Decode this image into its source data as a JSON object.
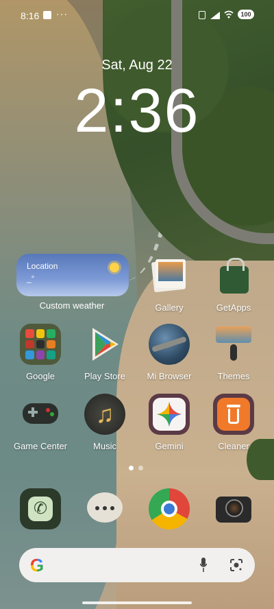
{
  "status_bar": {
    "time": "8:16",
    "dots": "···",
    "battery": "100"
  },
  "lockclock": {
    "date": "Sat, Aug 22",
    "time": "2:36"
  },
  "weather_widget": {
    "location": "Location",
    "temp": "_°",
    "label": "Custom weather"
  },
  "apps": {
    "gallery": "Gallery",
    "getapps": "GetApps",
    "google": "Google",
    "playstore": "Play Store",
    "mibrowser": "Mi Browser",
    "themes": "Themes",
    "gamecenter": "Game Center",
    "music": "Music",
    "gemini": "Gemini",
    "cleaner": "Cleaner"
  },
  "dock": [
    "Phone",
    "Messages",
    "Chrome",
    "Camera"
  ],
  "search_bar": {
    "g_letter": "G"
  },
  "pager": {
    "pages": 2,
    "active_page": 1
  }
}
